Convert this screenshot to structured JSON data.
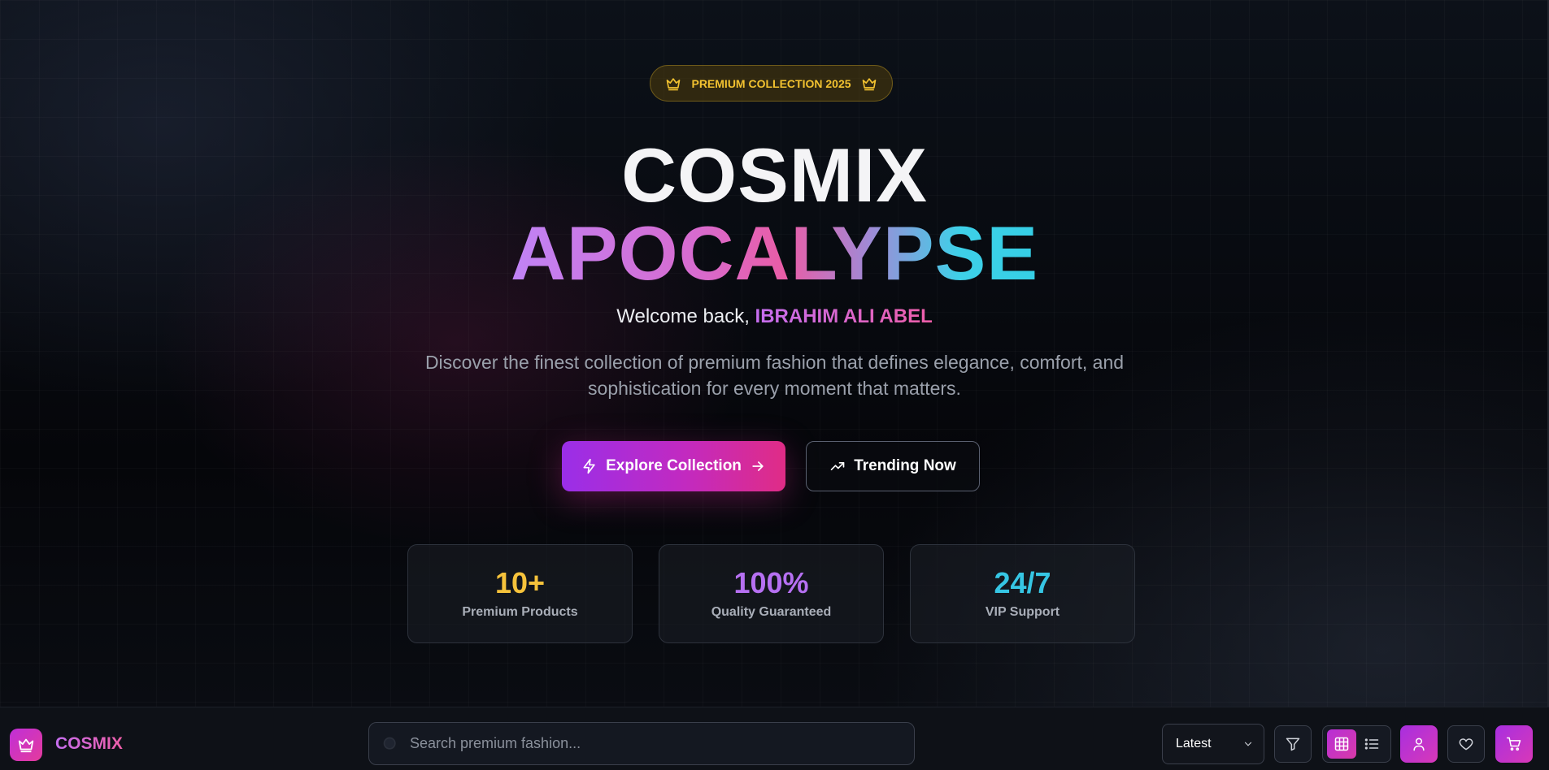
{
  "hero": {
    "badge_text": "PREMIUM COLLECTION 2025",
    "title_line1": "COSMIX",
    "title_line2": "APOCALYPSE",
    "welcome_prefix": "Welcome back, ",
    "user_name": "IBRAHIM ALI ABEL",
    "description": "Discover the finest collection of premium fashion that defines elegance, comfort, and sophistication for every moment that matters.",
    "primary_button": "Explore Collection",
    "secondary_button": "Trending Now"
  },
  "stats": [
    {
      "value": "10+",
      "label": "Premium Products",
      "color": "#f5c23b"
    },
    {
      "value": "100%",
      "label": "Quality Guaranteed",
      "color": "#b670f2"
    },
    {
      "value": "24/7",
      "label": "VIP Support",
      "color": "#36c6e4"
    }
  ],
  "bottom_bar": {
    "logo_text": "COSMIX",
    "search_placeholder": "Search premium fashion...",
    "sort_value": "Latest",
    "icons": [
      "crown-icon",
      "search-icon",
      "chevron-down-icon",
      "filter-icon",
      "grid-icon",
      "list-icon",
      "user-icon",
      "heart-icon",
      "cart-icon"
    ]
  },
  "colors": {
    "accent_purple": "#9a2ee8",
    "accent_pink": "#e02c86",
    "badge_gold": "#f2c230"
  }
}
